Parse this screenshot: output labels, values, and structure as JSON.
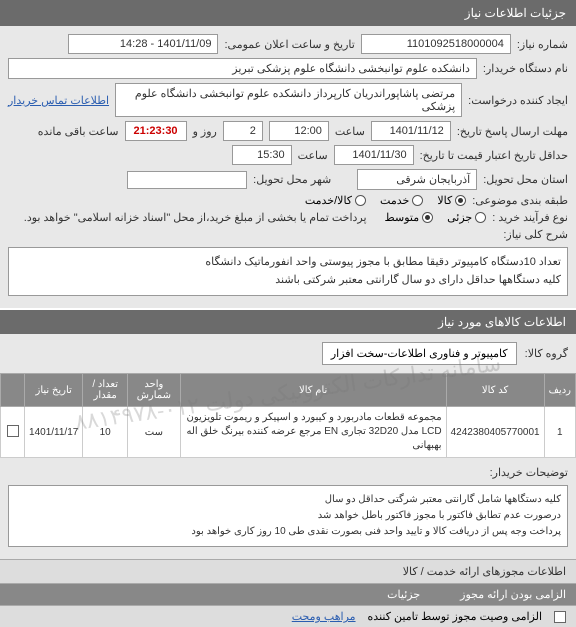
{
  "header": {
    "title": "جزئیات اطلاعات نیاز"
  },
  "form": {
    "need_no_label": "شماره نیاز:",
    "need_no": "1101092518000004",
    "announce_label": "تاریخ و ساعت اعلان عمومی:",
    "announce": "1401/11/09 - 14:28",
    "buyer_label": "نام دستگاه خریدار:",
    "buyer": "دانشکده علوم توانبخشی دانشگاه علوم پزشکی تبریز",
    "creator_label": "ایجاد کننده درخواست:",
    "creator": "مرتضی پاشاپوراندریان کارپرداز دانشکده علوم توانبخشی دانشگاه علوم پزشکی",
    "contact_link": "اطلاعات تماس خریدار",
    "send_deadline_label": "مهلت ارسال پاسخ تاریخ:",
    "send_date": "1401/11/12",
    "time_label": "ساعت",
    "send_time": "12:00",
    "day_label": "روز و",
    "days": "2",
    "remain_label": "ساعت باقی مانده",
    "countdown": "21:23:30",
    "min_valid_label": "حداقل تاریخ اعتبار قیمت تا تاریخ:",
    "valid_date": "1401/11/30",
    "valid_time": "15:30",
    "province_label": "استان محل تحویل:",
    "province": "آذربایجان شرقی",
    "city_label": "شهر محل تحویل:",
    "category_label": "طبقه بندی موضوعی:",
    "cat_goods": "کالا",
    "cat_service": "خدمت",
    "cat_both": "کالا/خدمت",
    "process_label": "نوع فرآیند خرید :",
    "proc_low": "جزئی",
    "proc_mid": "متوسط",
    "payment_note": "پرداخت تمام یا بخشی از مبلغ خرید،از محل \"اسناد خزانه اسلامی\" خواهد بود.",
    "desc_label": "شرح کلی نیاز:",
    "desc": "تعداد 10دستگاه کامپیوتر دقیقا مطابق با مجوز پیوستی واحد انفورماتیک دانشگاه\nکلیه دستگاهها حداقل  دارای دو سال گارانتی معتبر شرکتی باشند"
  },
  "goods_section": {
    "title": "اطلاعات کالاهای مورد نیاز",
    "group_label": "گروه کالا:",
    "group": "کامپیوتر و فناوری اطلاعات-سخت افزار"
  },
  "table": {
    "headers": [
      "ردیف",
      "کد کالا",
      "نام کالا",
      "واحد شمارش",
      "تعداد / مقدار",
      "تاریخ نیاز",
      ""
    ],
    "rows": [
      {
        "idx": "1",
        "code": "4242380405770001",
        "name": "مجموعه قطعات مادربورد و کیبورد و اسپیکر و ریموت تلویزیون LCD مدل 32D20 تجاری EN مرجع عرضه کننده بیرنگ خلق اله بهبهانی",
        "unit": "ست",
        "qty": "10",
        "date": "1401/11/17"
      }
    ]
  },
  "notes": {
    "label": "توضیحات خریدار:",
    "text": "کلیه دستگاهها شامل گارانتی معتبر شرگتی حداقل دو سال\nدرصورت عدم تطابق فاکتور با مجوز  فاکتور باطل خواهد شد\nپرداخت وجه پس از دریافت کالا و تایید واحد فنی بصورت نقدی طی 10 روز کاری خواهد بود"
  },
  "licenses": {
    "title": "اطلاعات مجوزهای ارائه خدمت / کالا",
    "col1": "الزامی بودن ارائه مجوز",
    "col2": "جزئیات"
  },
  "bottom": {
    "mandatory": "الزامی وصیت مجوز توسط تامین کننده",
    "link": "مراهب ومحت"
  },
  "watermark": "سامانه تدارکات الکترونیکی دولت ۰۱۲-۸۸۱۴۹۷۸"
}
